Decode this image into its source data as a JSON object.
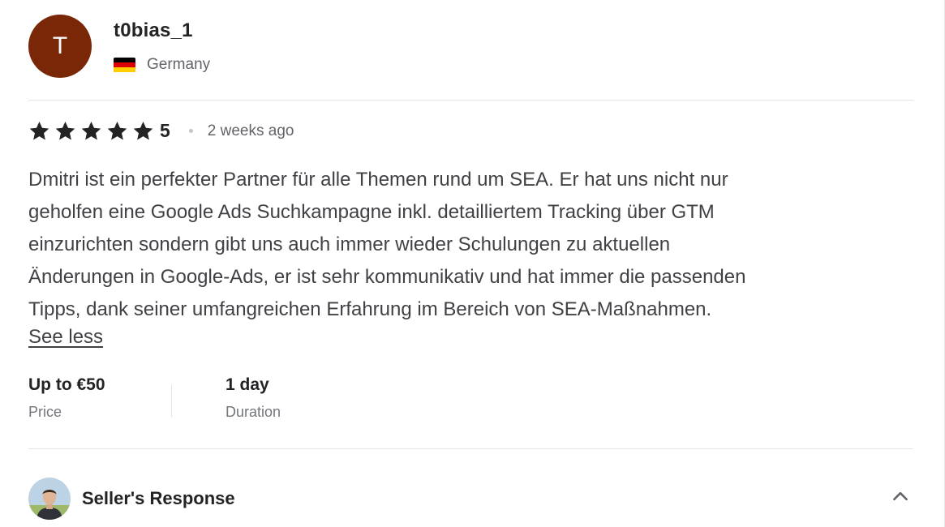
{
  "review": {
    "user": {
      "avatar_letter": "T",
      "avatar_color": "#7a2708",
      "username": "t0bias_1",
      "country": "Germany",
      "flag_icon": "germany-flag-icon",
      "flag_colors": [
        "#000000",
        "#dd0000",
        "#ffce00"
      ]
    },
    "rating": {
      "stars": 5,
      "value": "5",
      "star_color": "#222325"
    },
    "time_ago": "2 weeks ago",
    "text_lines": [
      "Dmitri ist ein perfekter Partner für alle Themen rund um SEA. Er hat uns nicht nur",
      "geholfen eine Google Ads Suchkampagne inkl. detailliertem Tracking über GTM",
      "einzurichten sondern gibt uns auch immer wieder Schulungen zu aktuellen",
      "Änderungen in Google-Ads, er ist sehr kommunikativ und hat immer die passenden",
      "Tipps, dank seiner umfangreichen Erfahrung im Bereich von SEA-Maßnahmen."
    ],
    "see_less_label": "See less",
    "price": {
      "value": "Up to €50",
      "label": "Price"
    },
    "duration": {
      "value": "1 day",
      "label": "Duration"
    },
    "seller_response": {
      "label": "Seller's Response",
      "toggle_icon": "chevron-up-icon"
    }
  }
}
